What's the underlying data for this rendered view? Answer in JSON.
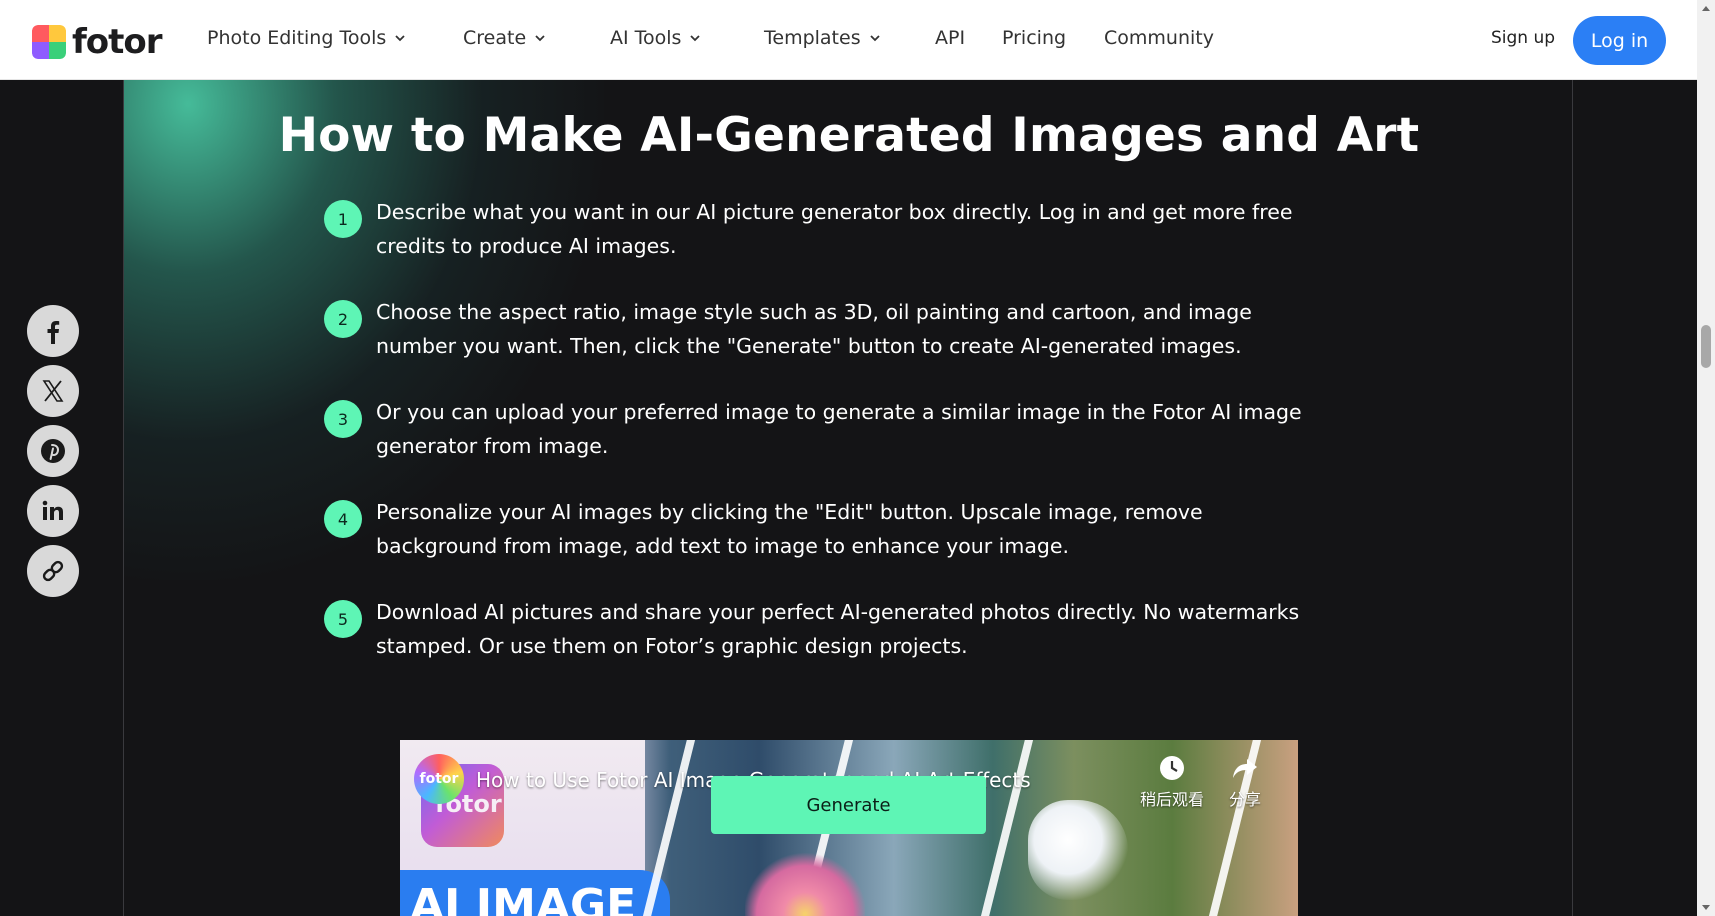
{
  "header": {
    "logo_text": "fotor",
    "nav": [
      {
        "label": "Photo Editing Tools",
        "has_dropdown": true
      },
      {
        "label": "Create",
        "has_dropdown": true
      },
      {
        "label": "AI Tools",
        "has_dropdown": true
      },
      {
        "label": "Templates",
        "has_dropdown": true
      },
      {
        "label": "API",
        "has_dropdown": false
      },
      {
        "label": "Pricing",
        "has_dropdown": false
      },
      {
        "label": "Community",
        "has_dropdown": false
      }
    ],
    "signup_label": "Sign up",
    "login_label": "Log in"
  },
  "main": {
    "title": "How to Make AI-Generated Images and Art",
    "steps": [
      {
        "num": "1",
        "text": "Describe what you want in our AI picture generator box directly. Log in and get more free credits to produce AI images."
      },
      {
        "num": "2",
        "text": "Choose the aspect ratio, image style such as 3D, oil painting and cartoon, and image number you want. Then, click the \"Generate\" button to create AI-generated images."
      },
      {
        "num": "3",
        "text": "Or you can upload your preferred image to generate a similar image in the Fotor AI image generator from image."
      },
      {
        "num": "4",
        "text": "Personalize your AI images by clicking the \"Edit\" button. Upscale image, remove background from image, add text to image to enhance your image."
      },
      {
        "num": "5",
        "text": "Download AI pictures and share your perfect AI-generated photos directly. No watermarks stamped. Or use them on Fotor’s graphic design projects."
      }
    ]
  },
  "video": {
    "channel_label": "fotor",
    "title": "How to Use Fotor AI Image Generator and AI Art Effects",
    "app_icon_text": "fotor",
    "thumbnail_text": "AI IMAGE",
    "watch_later_label": "稍后观看",
    "share_label": "分享"
  },
  "generate_label": "Generate",
  "share_icons": [
    "facebook-icon",
    "x-icon",
    "pinterest-icon",
    "linkedin-icon",
    "link-icon"
  ],
  "colors": {
    "accent_green": "#5ef5b5",
    "login_blue": "#2b7ff5",
    "background": "#141416"
  }
}
